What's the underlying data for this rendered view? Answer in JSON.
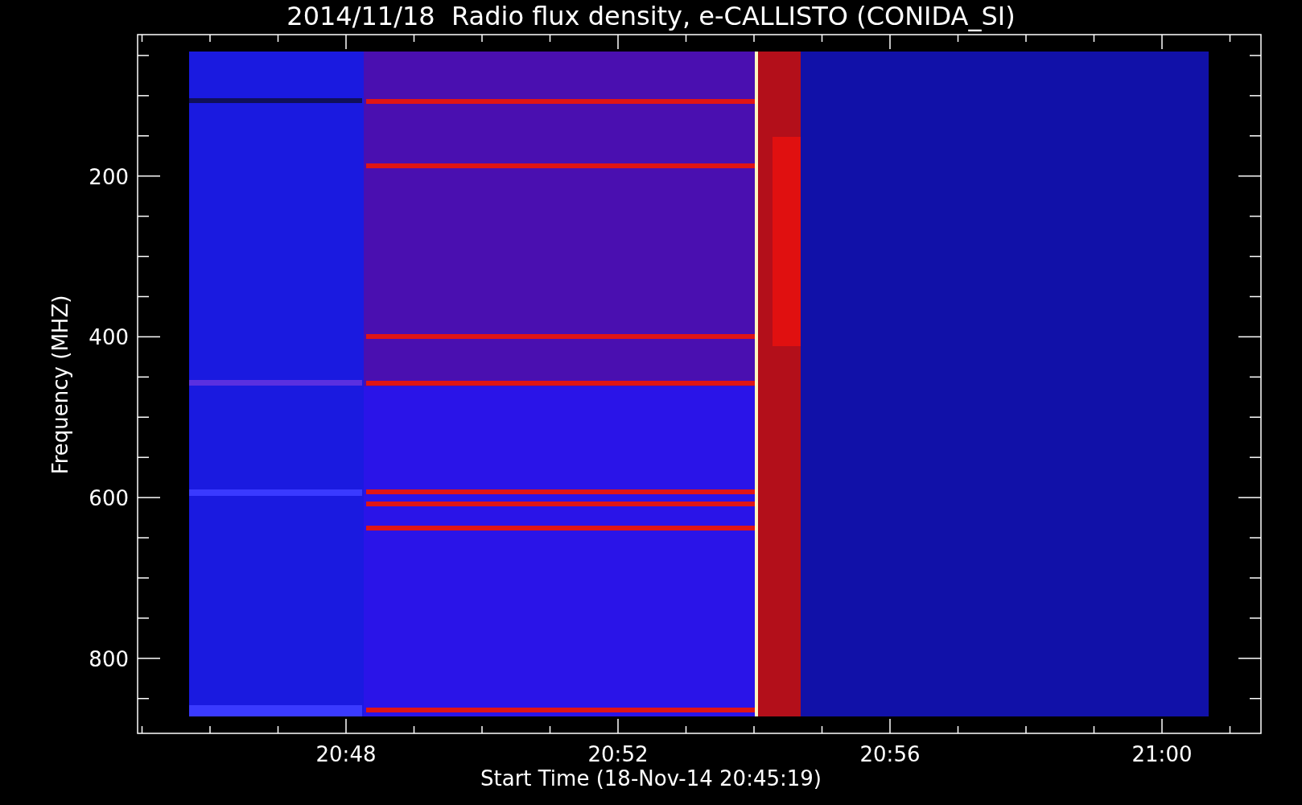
{
  "title": "2014/11/18  Radio flux density, e-CALLISTO (CONIDA_SI)",
  "y_axis": {
    "label": "Frequency (MHZ)",
    "ticks": [
      "200",
      "400",
      "600",
      "800"
    ]
  },
  "x_axis": {
    "label": "Start Time (18-Nov-14 20:45:19)",
    "ticks": [
      "20:48",
      "20:52",
      "20:56",
      "21:00"
    ]
  }
}
